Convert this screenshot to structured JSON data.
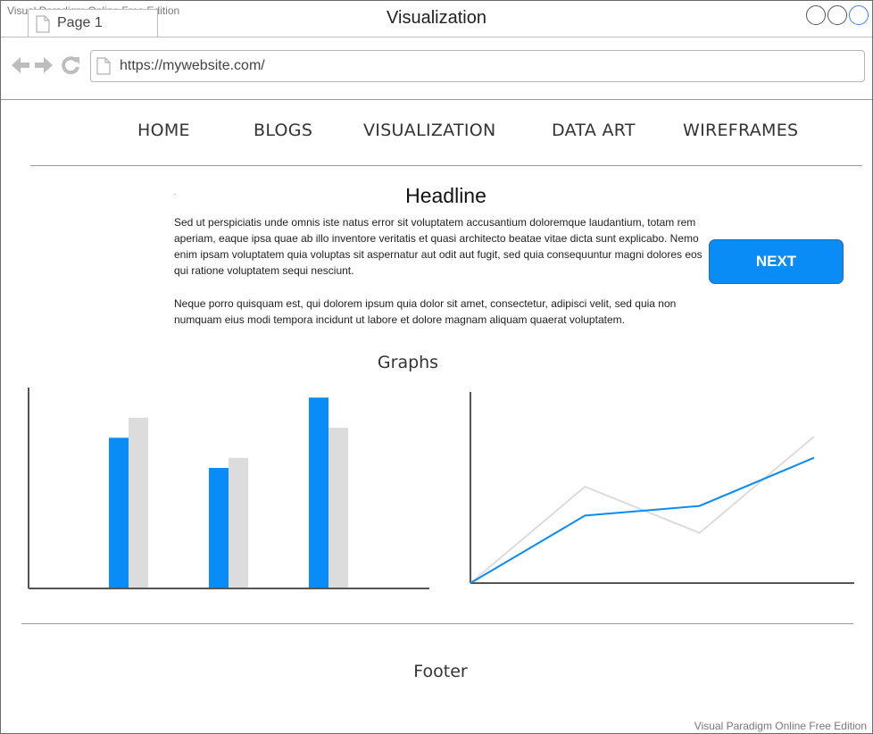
{
  "browser": {
    "watermark_top": "Visual Paradigm Online Free Edition",
    "tab_label": "Page 1",
    "window_title": "Visualization",
    "url": "https://mywebsite.com/"
  },
  "nav": {
    "items": [
      "HOME",
      "BLOGS",
      "VISUALIZATION",
      "DATA ART",
      "WIREFRAMES"
    ]
  },
  "content": {
    "dot": ".",
    "headline": "Headline",
    "paragraph1": "Sed ut perspiciatis unde omnis iste natus error sit voluptatem accusantium doloremque laudantium, totam rem aperiam, eaque ipsa quae ab illo inventore veritatis et quasi architecto beatae vitae dicta sunt explicabo. Nemo enim ipsam voluptatem quia voluptas sit aspernatur aut odit aut fugit, sed quia consequuntur magni dolores eos qui ratione voluptatem sequi nesciunt.",
    "paragraph2": "Neque porro quisquam est, qui dolorem ipsum quia dolor sit amet, consectetur, adipisci velit, sed quia non numquam eius modi tempora incidunt ut labore et dolore magnam aliquam quaerat voluptatem.",
    "next_label": "NEXT",
    "graphs_title": "Graphs",
    "footer": "Footer",
    "watermark_bottom": "Visual Paradigm Online Free Edition"
  },
  "colors": {
    "accent": "#0a8cf7",
    "secondary_series": "#dcdcdc",
    "axis": "#555555"
  },
  "chart_data": [
    {
      "type": "bar",
      "categories": [
        "",
        "",
        ""
      ],
      "series": [
        {
          "values": [
            75,
            60,
            95
          ],
          "color": "#0a8cf7"
        },
        {
          "values": [
            85,
            65,
            80
          ],
          "color": "#dcdcdc"
        }
      ],
      "ylim": [
        0,
        100
      ],
      "grid": false
    },
    {
      "type": "line",
      "x": [
        0,
        1,
        2,
        3
      ],
      "series": [
        {
          "values": [
            0,
            35,
            40,
            65
          ],
          "color": "#0a8cf7"
        },
        {
          "values": [
            0,
            50,
            26,
            76
          ],
          "color": "#dcdcdc"
        }
      ],
      "ylim": [
        0,
        100
      ],
      "grid": false
    }
  ]
}
